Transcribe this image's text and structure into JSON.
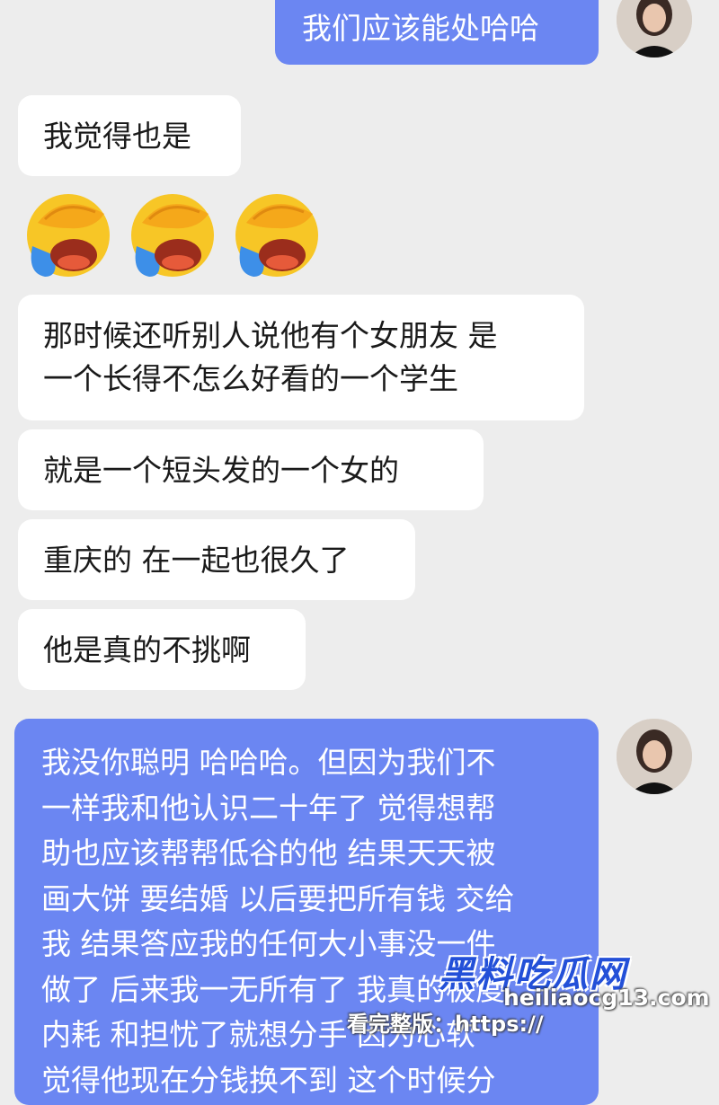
{
  "colors": {
    "background": "#ededed",
    "incoming_bubble": "#ffffff",
    "outgoing_bubble": "#6b86f2",
    "watermark_blue": "#2350d8"
  },
  "messages": [
    {
      "side": "right",
      "text": "我们应该能处哈哈"
    },
    {
      "side": "left",
      "text": "我觉得也是"
    },
    {
      "side": "left",
      "emoji": "facepalm-crying-laughing-emoji",
      "count": 3
    },
    {
      "side": "left",
      "text": "那时候还听别人说他有个女朋友 是\n一个长得不怎么好看的一个学生"
    },
    {
      "side": "left",
      "text": "就是一个短头发的一个女的"
    },
    {
      "side": "left",
      "text": "重庆的 在一起也很久了"
    },
    {
      "side": "left",
      "text": "他是真的不挑啊"
    },
    {
      "side": "right",
      "text": "我没你聪明 哈哈哈。但因为我们不\n一样我和他认识二十年了 觉得想帮\n助也应该帮帮低谷的他 结果天天被\n画大饼 要结婚 以后要把所有钱 交给\n我 结果答应我的任何大小事没一件\n做了 后来我一无所有了 我真的极度\n内耗 和担忧了就想分手 因为心软\n觉得他现在分钱换不到 这个时候分"
    }
  ],
  "watermark": {
    "logo": "黑料吃瓜网",
    "url": "heiliaocg13.com",
    "prompt": "看完整版：https://"
  }
}
